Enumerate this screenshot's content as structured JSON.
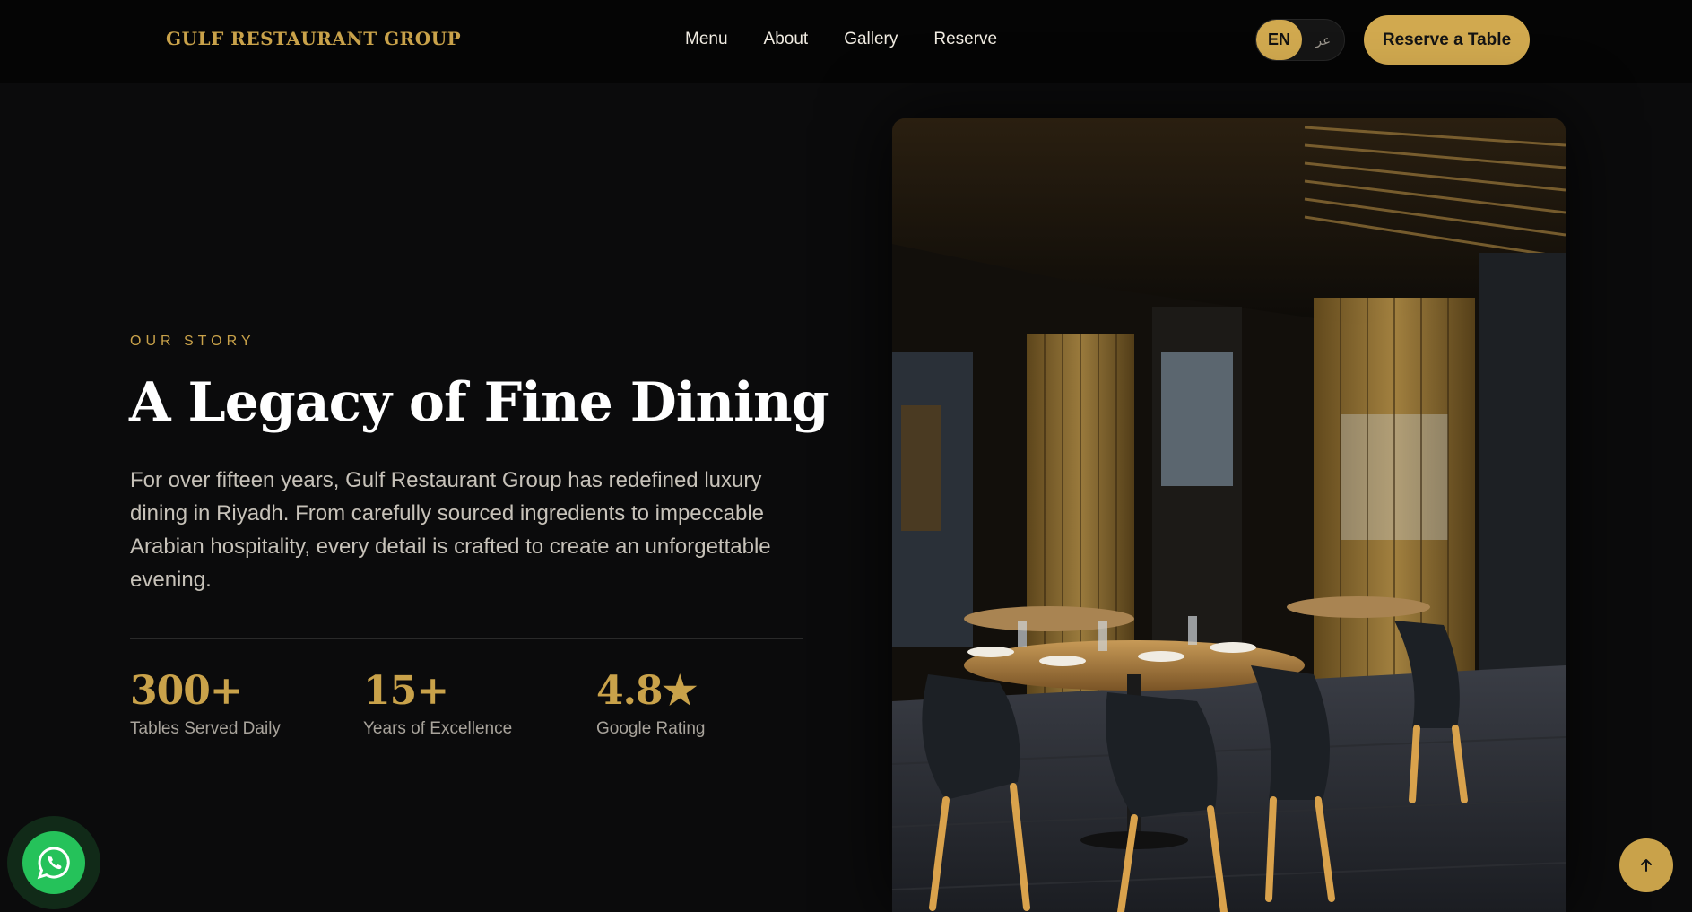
{
  "header": {
    "logo": "GULF RESTAURANT GROUP",
    "nav": [
      "Menu",
      "About",
      "Gallery",
      "Reserve"
    ],
    "language": {
      "active": "EN",
      "inactive": "عر"
    },
    "cta_label": "Reserve a Table"
  },
  "hero": {
    "eyebrow": "OUR STORY",
    "title": "A Legacy of Fine Dining",
    "description": "For over fifteen years, Gulf Restaurant Group has redefined luxury dining in Riyadh. From carefully sourced ingredients to impeccable Arabian hospitality, every detail is crafted to create an unforgettable evening.",
    "stats": [
      {
        "value": "300+",
        "label": "Tables Served Daily"
      },
      {
        "value": "15+",
        "label": "Years of Excellence"
      },
      {
        "value": "4.8★",
        "label": "Google Rating"
      }
    ],
    "image_subject": "restaurant-interior-photo"
  },
  "floating": {
    "whatsapp_icon": "whatsapp-icon",
    "to_top_icon": "arrow-up-icon"
  },
  "colors": {
    "accent": "#c9a24a",
    "background": "#0b0b0c",
    "whatsapp": "#25c25a"
  }
}
